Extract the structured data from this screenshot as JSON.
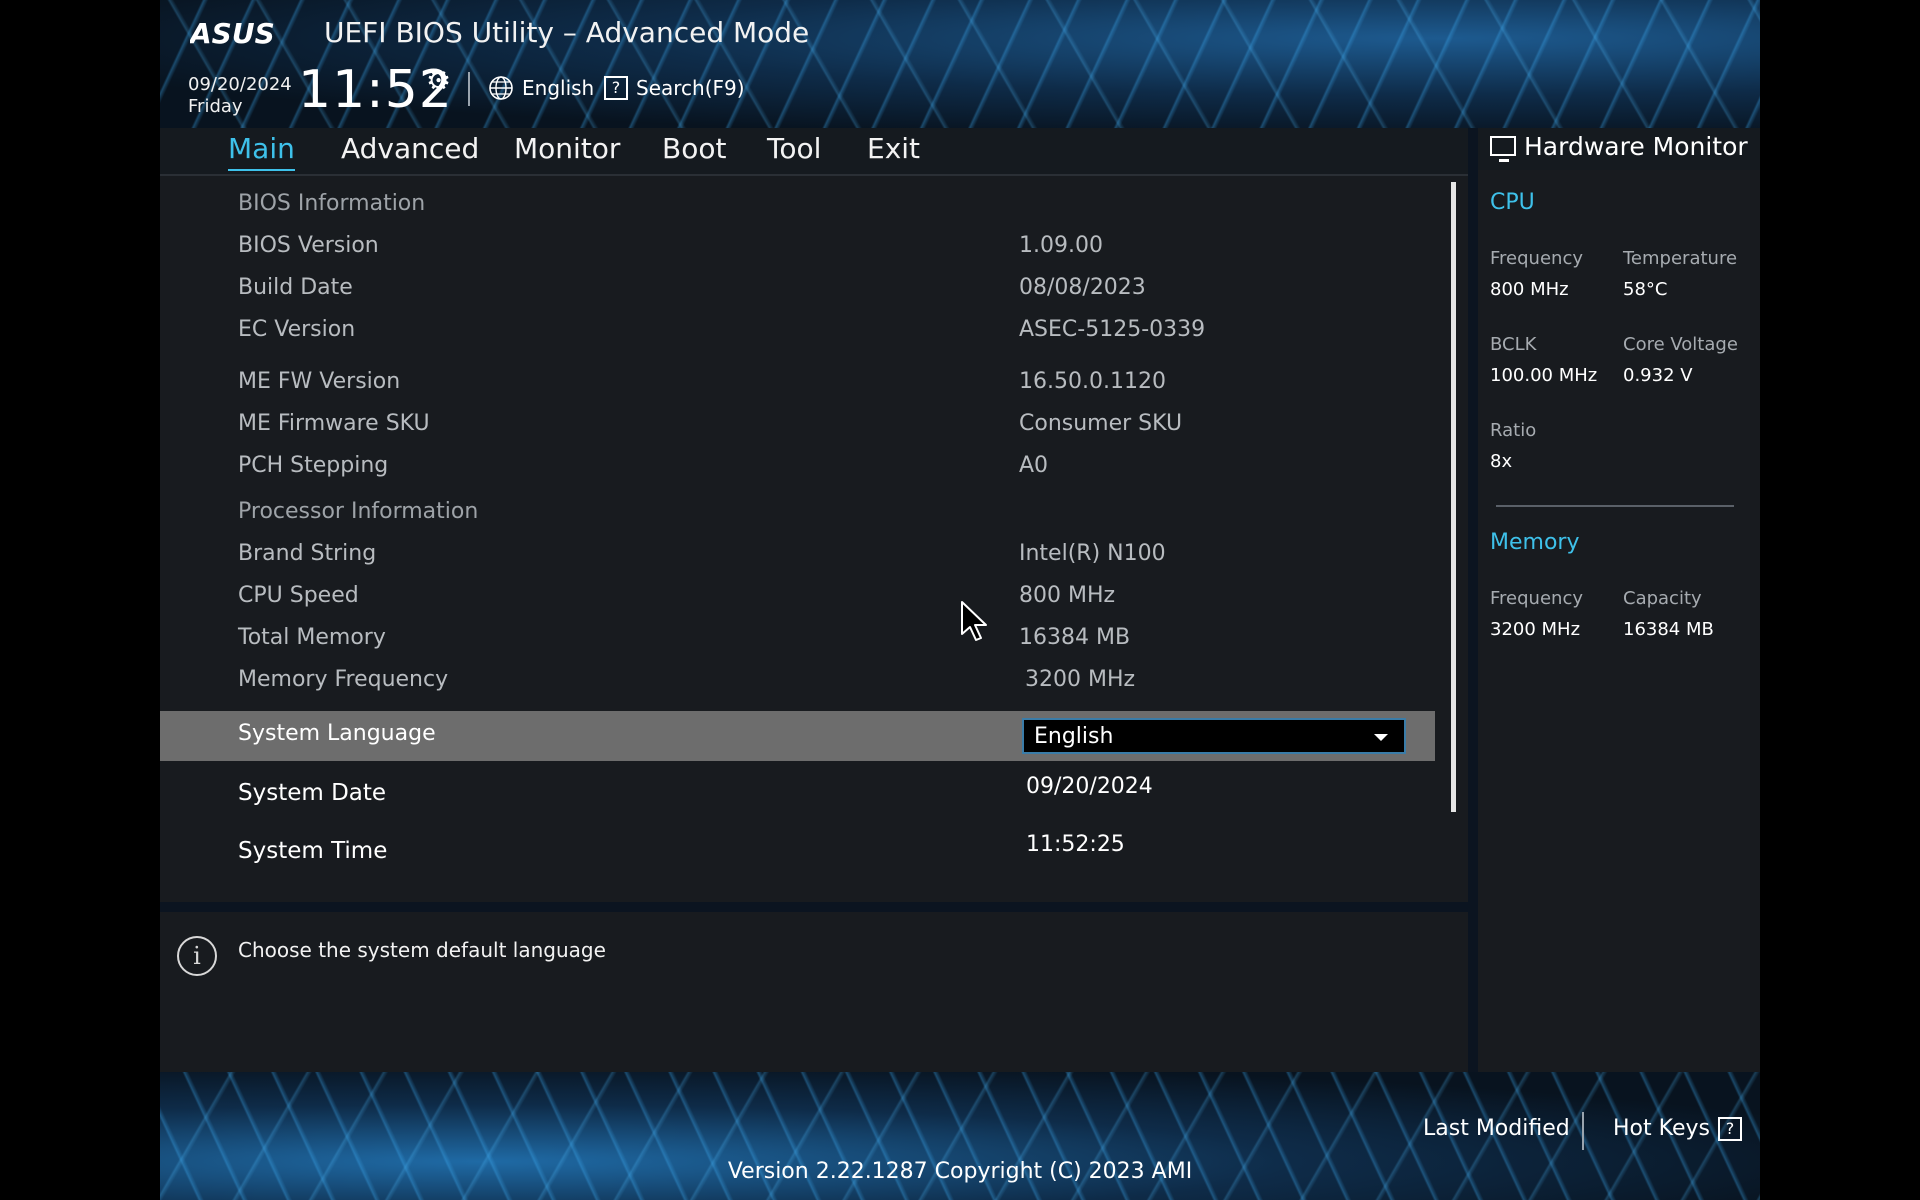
{
  "header": {
    "brand": "ASUS",
    "title": "UEFI BIOS Utility – Advanced Mode",
    "date": "09/20/2024",
    "day": "Friday",
    "time": "11:52",
    "language": "English",
    "search": "Search(F9)"
  },
  "nav": {
    "tabs": [
      "Main",
      "Advanced",
      "Monitor",
      "Boot",
      "Tool",
      "Exit"
    ],
    "active": "Main"
  },
  "main": {
    "bios_info_header": "BIOS Information",
    "bios_version_label": "BIOS Version",
    "bios_version_value": "1.09.00",
    "build_date_label": "Build Date",
    "build_date_value": "08/08/2023",
    "ec_version_label": "EC Version",
    "ec_version_value": "ASEC-5125-0339",
    "me_fw_label": "ME FW Version",
    "me_fw_value": "16.50.0.1120",
    "me_sku_label": "ME Firmware SKU",
    "me_sku_value": "Consumer SKU",
    "pch_label": "PCH Stepping",
    "pch_value": "A0",
    "proc_info_header": "Processor Information",
    "brand_label": "Brand String",
    "brand_value": "Intel(R) N100",
    "cpu_speed_label": "CPU Speed",
    "cpu_speed_value": "800 MHz",
    "total_mem_label": "Total Memory",
    "total_mem_value": "16384 MB",
    "mem_freq_label": "Memory Frequency",
    "mem_freq_value": "3200 MHz",
    "sys_lang_label": "System Language",
    "sys_lang_value": "English",
    "sys_date_label": "System Date",
    "sys_date_value": "09/20/2024",
    "sys_time_label": "System Time",
    "sys_time_value": "11:52:25"
  },
  "help": {
    "text": "Choose the system default language"
  },
  "hw": {
    "title": "Hardware Monitor",
    "cpu": {
      "title": "CPU",
      "freq_label": "Frequency",
      "freq": "800 MHz",
      "temp_label": "Temperature",
      "temp": "58°C",
      "bclk_label": "BCLK",
      "bclk": "100.00 MHz",
      "volt_label": "Core Voltage",
      "volt": "0.932 V",
      "ratio_label": "Ratio",
      "ratio": "8x"
    },
    "memory": {
      "title": "Memory",
      "freq_label": "Frequency",
      "freq": "3200 MHz",
      "cap_label": "Capacity",
      "cap": "16384 MB"
    }
  },
  "footer": {
    "last_modified": "Last Modified",
    "hot_keys": "Hot Keys",
    "version": "Version 2.22.1287 Copyright (C) 2023 AMI"
  },
  "colors": {
    "accent": "#3ec1ea",
    "selected_row": "#6d6d6d",
    "panel": "#181b1f"
  }
}
